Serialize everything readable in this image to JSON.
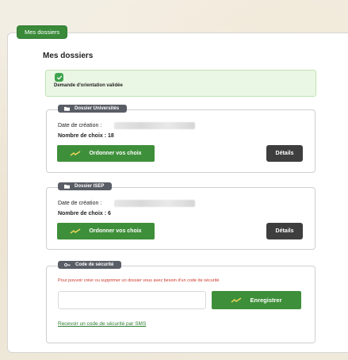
{
  "header": {
    "tab_label": "Mes dossiers"
  },
  "main": {
    "title": "Mes dossiers",
    "alert": {
      "text": "Demande d'orientation validée",
      "icon": "check-icon"
    },
    "dossiers": [
      {
        "tag": "Dossier Universités",
        "date_label": "Date de création :",
        "count_label": "Nombre de choix : 18",
        "order_button": "Ordonner vos choix",
        "details_button": "Détails"
      },
      {
        "tag": "Dossier ISEP",
        "date_label": "Date de création :",
        "count_label": "Nombre de choix : 6",
        "order_button": "Ordonner vos choix",
        "details_button": "Détails"
      }
    ],
    "security": {
      "tag": "Code de sécurité",
      "warning": "Pour pouvoir créer ou supprimer un dossier vous avez besoin d'un code de sécurité",
      "input_placeholder": "",
      "save_button": "Enregistrer",
      "sms_link": "Recevoir un code de sécurité par SMS"
    }
  },
  "colors": {
    "primary_green": "#3e8f3a",
    "dark_button": "#3e3e3e",
    "tag_gray": "#595d66",
    "warning_red": "#c9372c",
    "alert_bg": "#eaf7e5"
  }
}
